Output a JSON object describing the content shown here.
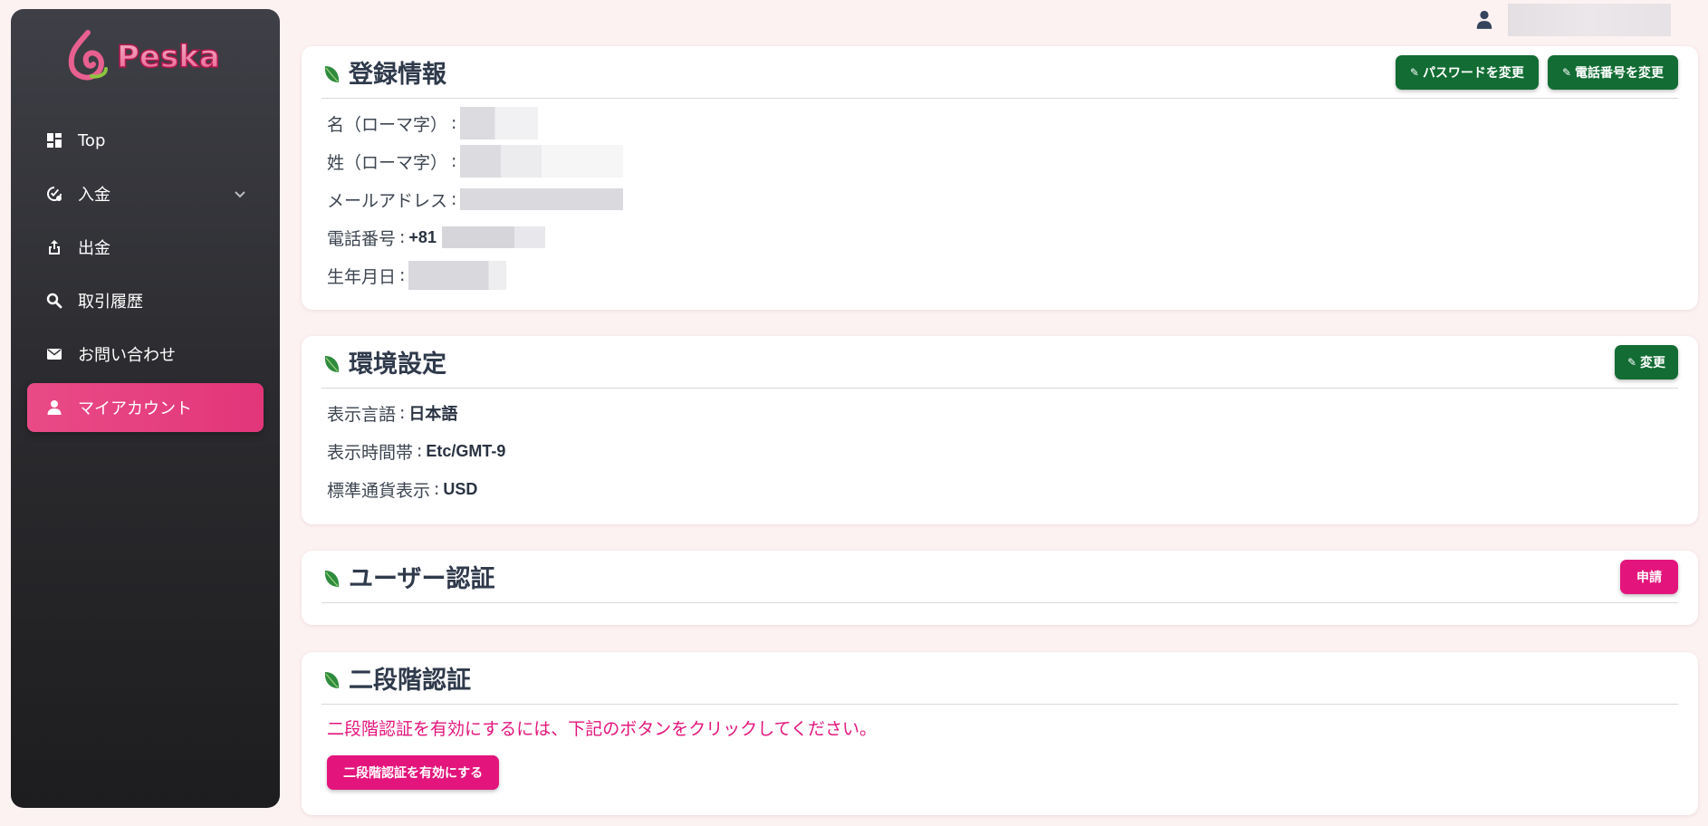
{
  "brand": {
    "name": "Peska"
  },
  "sidebar": {
    "items": [
      {
        "label": "Top",
        "icon": "dashboard-icon"
      },
      {
        "label": "入金",
        "icon": "deposit-icon",
        "has_chevron": true
      },
      {
        "label": "出金",
        "icon": "withdraw-icon"
      },
      {
        "label": "取引履歴",
        "icon": "search-icon"
      },
      {
        "label": "お問い合わせ",
        "icon": "mail-icon"
      },
      {
        "label": "マイアカウント",
        "icon": "user-icon",
        "active": true
      }
    ]
  },
  "registration": {
    "title": "登録情報",
    "change_password_label": "パスワードを変更",
    "change_phone_label": "電話番号を変更",
    "fields": {
      "first_name_label": "名（ローマ字）",
      "last_name_label": "姓（ローマ字）",
      "email_label": "メールアドレス",
      "phone_label": "電話番号",
      "phone_prefix": "+81",
      "birthdate_label": "生年月日"
    }
  },
  "preferences": {
    "title": "環境設定",
    "change_label": "変更",
    "language_label": "表示言語",
    "language_value": "日本語",
    "timezone_label": "表示時間帯",
    "timezone_value": "Etc/GMT-9",
    "currency_label": "標準通貨表示",
    "currency_value": "USD"
  },
  "verification": {
    "title": "ユーザー認証",
    "apply_label": "申請"
  },
  "two_factor": {
    "title": "二段階認証",
    "notice": "二段階認証を有効にするには、下記のボタンをクリックしてください。",
    "enable_label": "二段階認証を有効にする"
  },
  "colors": {
    "accent_pink": "#e3157c",
    "active_nav": "#e94b86",
    "button_green": "#126c33",
    "page_bg": "#fdf2f2"
  }
}
